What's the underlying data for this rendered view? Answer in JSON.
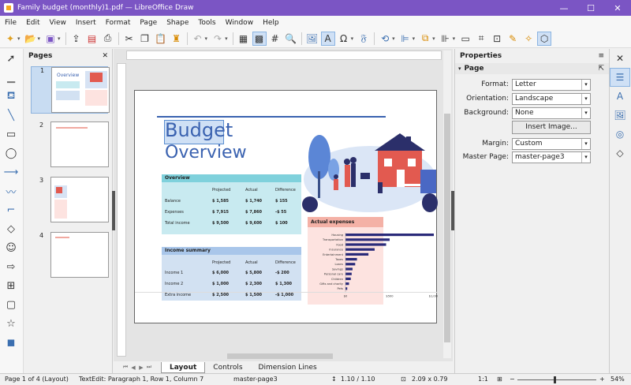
{
  "window": {
    "title": "Family budget (monthly)1.pdf — LibreOffice Draw",
    "minimize": "—",
    "maximize": "☐",
    "close": "✕"
  },
  "menu": [
    "File",
    "Edit",
    "View",
    "Insert",
    "Format",
    "Page",
    "Shape",
    "Tools",
    "Window",
    "Help"
  ],
  "pages_panel": {
    "title": "Pages",
    "close": "✕",
    "thumbs": [
      {
        "num": "1"
      },
      {
        "num": "2"
      },
      {
        "num": "3"
      },
      {
        "num": "4"
      }
    ],
    "thumb1_title": "Overview"
  },
  "tabs": [
    "Layout",
    "Controls",
    "Dimension Lines"
  ],
  "properties": {
    "title": "Properties",
    "section": "Page",
    "format_label": "Format:",
    "format_value": "Letter",
    "orientation_label": "Orientation:",
    "orientation_value": "Landscape",
    "background_label": "Background:",
    "background_value": "None",
    "insert_image": "Insert Image...",
    "margin_label": "Margin:",
    "margin_value": "Custom",
    "master_label": "Master Page:",
    "master_value": "master-page3"
  },
  "document": {
    "title1": "Budget",
    "title2": "Overview",
    "overview": {
      "header": "Overview",
      "cols": [
        "Projected",
        "Actual",
        "Difference"
      ],
      "rows": [
        {
          "label": "Balance",
          "p": "$ 1,585",
          "a": "$ 1,740",
          "d": "$ 155"
        },
        {
          "label": "Expenses",
          "p": "$ 7,915",
          "a": "$ 7,860",
          "d": "-$ 55"
        },
        {
          "label": "Total income",
          "p": "$ 9,500",
          "a": "$ 9,600",
          "d": "$ 100"
        }
      ]
    },
    "income": {
      "header": "Income summary",
      "cols": [
        "Projected",
        "Actual",
        "Difference"
      ],
      "rows": [
        {
          "label": "Income 1",
          "p": "$ 6,000",
          "a": "$ 5,800",
          "d": "-$ 200"
        },
        {
          "label": "Income 2",
          "p": "$ 1,000",
          "a": "$ 2,300",
          "d": "$ 1,300"
        },
        {
          "label": "Extra income",
          "p": "$ 2,500",
          "a": "$ 1,500",
          "d": "-$ 1,000"
        }
      ]
    },
    "expenses": {
      "header": "Actual expenses",
      "categories": [
        "Housing",
        "Transportation",
        "Food",
        "Insurance",
        "Entertainment",
        "Taxes",
        "Loans",
        "Savings",
        "Personal care",
        "Children",
        "Gifts and charity",
        "Pets"
      ],
      "values": [
        1000,
        500,
        460,
        330,
        260,
        130,
        110,
        80,
        70,
        60,
        40,
        20
      ],
      "ticks": [
        "$0",
        "$500",
        "$1,000"
      ]
    }
  },
  "colors": {
    "accent": "#7b55c4",
    "doc_blue": "#3a62b0",
    "bar": "#2a2a7a",
    "overview_bg": "#c8eaf0",
    "overview_hdr": "#7fd1dc",
    "income_bg": "#d2e1f2",
    "income_hdr": "#a9c6ea",
    "expense_hdr": "#f4b1a6",
    "expense_bg": "#fde3e0"
  },
  "status": {
    "page": "Page 1 of 4 (Layout)",
    "edit": "TextEdit: Paragraph 1, Row 1, Column 7",
    "master": "master-page3",
    "pos": "1.10 / 1.10",
    "size": "2.09 x 0.79",
    "ratio": "1:1",
    "zoom": "54%"
  }
}
